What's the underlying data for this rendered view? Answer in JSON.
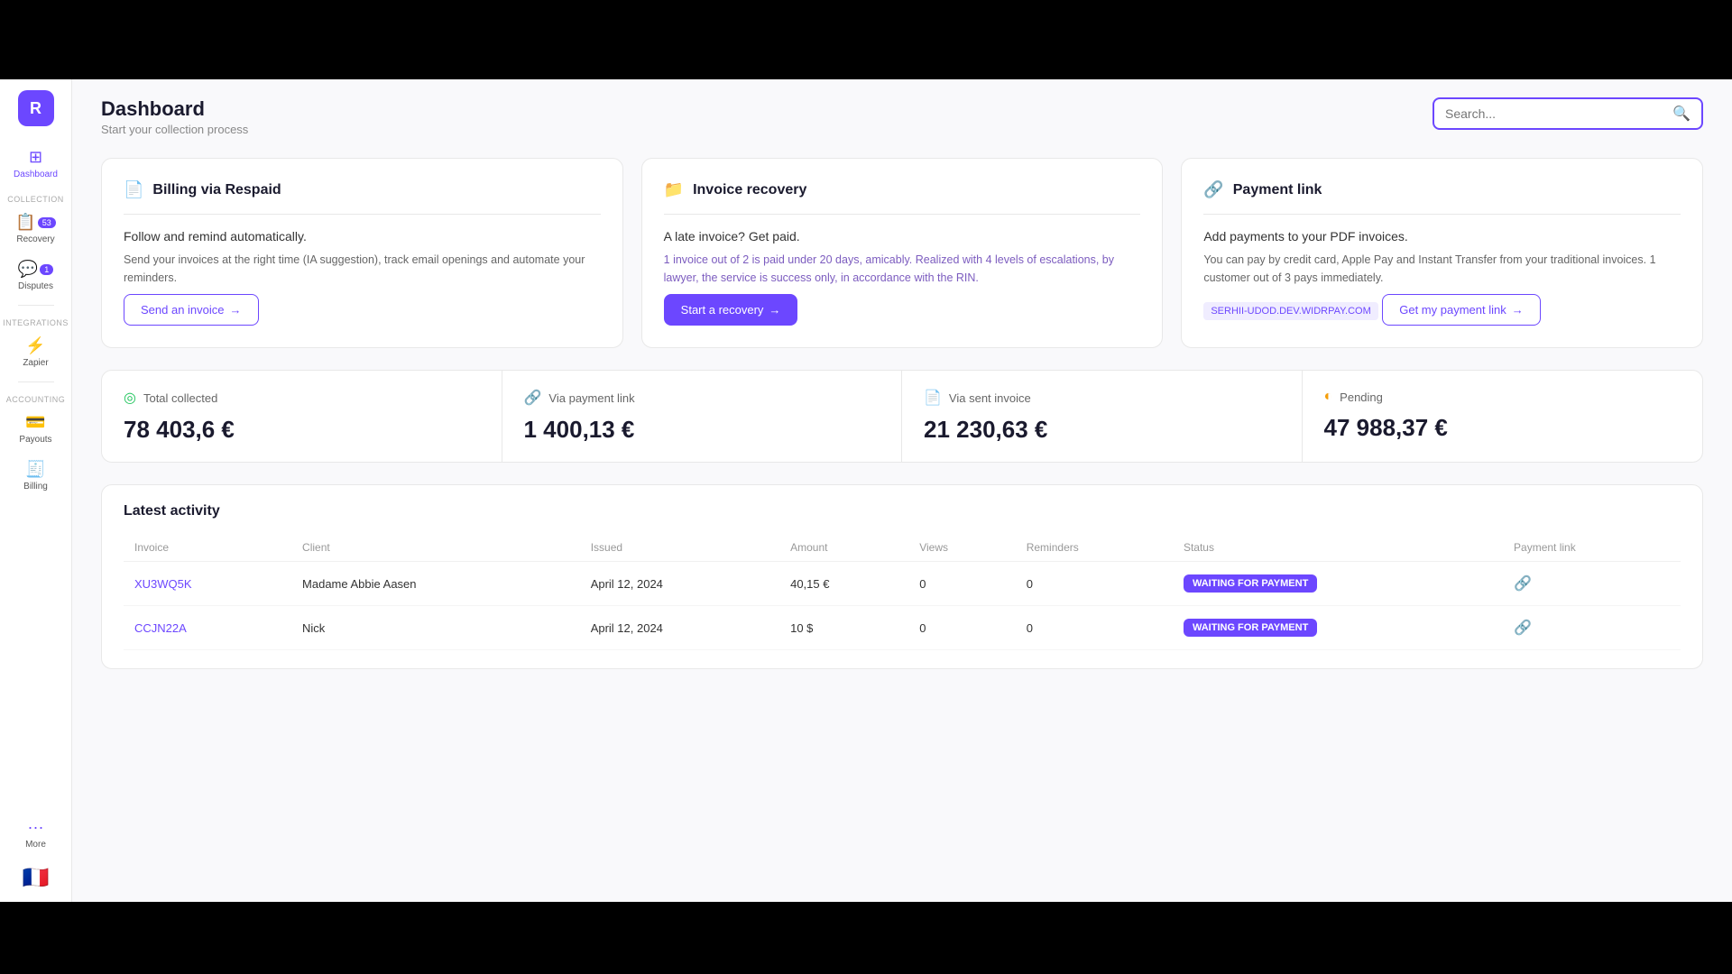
{
  "topBar": {},
  "bottomBar": {},
  "sidebar": {
    "logo": "R",
    "items": [
      {
        "id": "dashboard",
        "label": "Dashboard",
        "icon": "⊞",
        "active": true
      },
      {
        "id": "collection-section",
        "label": "COLLECTION",
        "isSection": true
      },
      {
        "id": "recovery",
        "label": "Recovery",
        "icon": "📋",
        "badge": "53"
      },
      {
        "id": "disputes",
        "label": "Disputes",
        "icon": "💬",
        "badge": "1"
      },
      {
        "id": "integrations-section",
        "label": "INTEGRATIONS",
        "isSection": true
      },
      {
        "id": "zapier",
        "label": "Zapier",
        "icon": "⚡"
      },
      {
        "id": "accounting-section",
        "label": "ACCOUNTING",
        "isSection": true
      },
      {
        "id": "payouts",
        "label": "Payouts",
        "icon": "💳"
      },
      {
        "id": "billing",
        "label": "Billing",
        "icon": "🧾"
      },
      {
        "id": "more",
        "label": "More",
        "icon": "···"
      }
    ],
    "countryFlag": "🇫🇷"
  },
  "header": {
    "title": "Dashboard",
    "subtitle": "Start your collection process",
    "search": {
      "placeholder": "Search...",
      "value": ""
    }
  },
  "cards": [
    {
      "id": "billing",
      "icon": "📄",
      "title": "Billing via Respaid",
      "subtitle": "Follow and remind automatically.",
      "description": "Send your invoices at the right time (IA suggestion), track email openings and automate your reminders.",
      "buttonLabel": "Send an invoice",
      "buttonStyle": "outline"
    },
    {
      "id": "invoice-recovery",
      "icon": "📁",
      "title": "Invoice recovery",
      "subtitle": "A late invoice? Get paid.",
      "description": "1 invoice out of 2 is paid under 20 days, amicably. Realized with 4 levels of escalations, by lawyer, the service is success only, in accordance with the RIN.",
      "buttonLabel": "Start a recovery",
      "buttonStyle": "filled"
    },
    {
      "id": "payment-link",
      "icon": "🔗",
      "title": "Payment link",
      "subtitle": "Add payments to your PDF invoices.",
      "description": "You can pay by credit card, Apple Pay and Instant Transfer from your traditional invoices. 1 customer out of 3 pays immediately.",
      "linkText": "SERHII-UDOD.DEV.WIDRPAY.COM",
      "buttonLabel": "Get my payment link",
      "buttonStyle": "outline"
    }
  ],
  "stats": [
    {
      "id": "total-collected",
      "icon": "◎",
      "iconClass": "green",
      "label": "Total collected",
      "value": "78 403,6 €"
    },
    {
      "id": "via-payment-link",
      "icon": "🔗",
      "iconClass": "purple",
      "label": "Via payment link",
      "value": "1 400,13 €"
    },
    {
      "id": "via-sent-invoice",
      "icon": "📄",
      "iconClass": "blue",
      "label": "Via sent invoice",
      "value": "21 230,63 €"
    },
    {
      "id": "pending",
      "icon": "◐",
      "iconClass": "orange",
      "label": "Pending",
      "value": "47 988,37 €"
    }
  ],
  "activity": {
    "title": "Latest activity",
    "columns": [
      "Invoice",
      "Client",
      "Issued",
      "Amount",
      "Views",
      "Reminders",
      "Status",
      "Payment link"
    ],
    "rows": [
      {
        "invoice": "XU3WQ5K",
        "client": "Madame Abbie Aasen",
        "issued": "April 12, 2024",
        "amount": "40,15 €",
        "views": "0",
        "reminders": "0",
        "status": "WAITING FOR PAYMENT",
        "hasLink": true
      },
      {
        "invoice": "CCJN22A",
        "client": "Nick",
        "issued": "April 12, 2024",
        "amount": "10 $",
        "views": "0",
        "reminders": "0",
        "status": "WAITING FOR PAYMENT",
        "hasLink": true
      }
    ]
  }
}
